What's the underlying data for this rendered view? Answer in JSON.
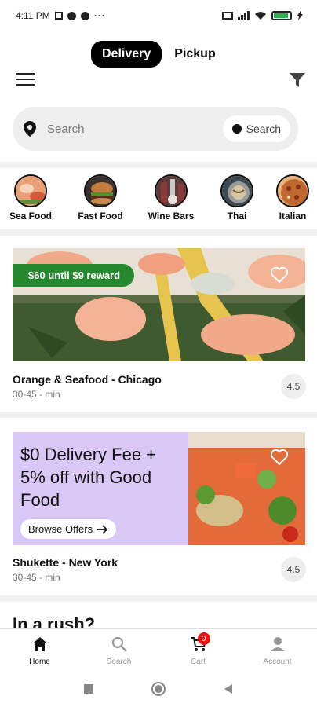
{
  "status_bar": {
    "time": "4:11 PM",
    "icons": [
      "image-icon",
      "record-icon",
      "navigation-icon"
    ],
    "more": "···",
    "right_icons": [
      "vpn-icon",
      "signal-icon",
      "wifi-icon",
      "battery-icon"
    ]
  },
  "mode_toggle": {
    "delivery": "Delivery",
    "pickup": "Pickup",
    "selected": "Delivery"
  },
  "search": {
    "placeholder": "Search",
    "button_label": "Search"
  },
  "categories": [
    {
      "label": "Sea Food",
      "color": "#e8a077"
    },
    {
      "label": "Fast Food",
      "color": "#c27c3e"
    },
    {
      "label": "Wine Bars",
      "color": "#8b3a3a"
    },
    {
      "label": "Thai",
      "color": "#9a9a9a"
    },
    {
      "label": "Italian",
      "color": "#c0692f"
    }
  ],
  "restaurants": [
    {
      "name": "Orange & Seafood - Chicago",
      "time": "30-45 - min",
      "rating": "4.5",
      "reward": "$60 until $9 reward"
    },
    {
      "name": "Shukette - New York",
      "time": "30-45 - min",
      "rating": "4.5"
    }
  ],
  "promo": {
    "title": "$0 Delivery Fee + 5% off with Good Food",
    "cta": "Browse Offers"
  },
  "section_heading": "In a rush?",
  "bottom_nav": [
    {
      "label": "Home",
      "icon": "home-icon",
      "active": true
    },
    {
      "label": "Search",
      "icon": "search-icon",
      "active": false
    },
    {
      "label": "Cart",
      "icon": "cart-icon",
      "active": false,
      "badge": "0"
    },
    {
      "label": "Account",
      "icon": "account-icon",
      "active": false
    }
  ],
  "colors": {
    "accent": "#000000",
    "reward_green": "#27892f",
    "promo_bg": "#d9c7f6",
    "badge_red": "#e11111"
  }
}
